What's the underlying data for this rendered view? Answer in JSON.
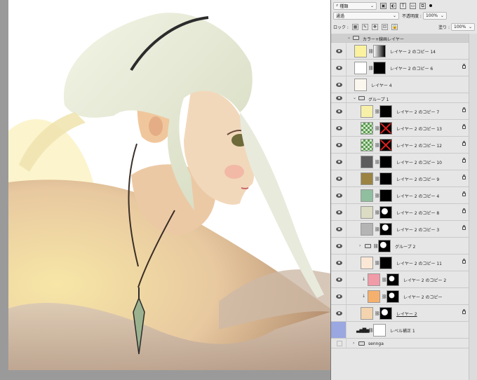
{
  "panel": {
    "search_kind": "種類",
    "blend_mode": "通過",
    "opacity_label": "不透明度 :",
    "opacity_value": "100%",
    "lock_label": "ロック :",
    "fill_label": "塗り :",
    "fill_value": "100%"
  },
  "layers": [
    {
      "name": "カラー+線画レイヤー",
      "kind": "group-header"
    },
    {
      "name": "レイヤー 2 のコピー 14",
      "thumb": "#fbf2a0",
      "mask": "gradient",
      "locked": false
    },
    {
      "name": "レイヤー 2 のコピー 6",
      "thumb": "#ffffff",
      "mask": "black",
      "locked": true
    },
    {
      "name": "レイヤー 4",
      "thumb": "sketch",
      "mask": "none",
      "locked": false
    },
    {
      "name": "グループ 1",
      "kind": "group"
    },
    {
      "name": "レイヤー 2 のコピー 7",
      "thumb": "#f7f0a8",
      "mask": "black",
      "locked": true
    },
    {
      "name": "レイヤー 2 のコピー 13",
      "thumb": "checker",
      "mask": "disabled",
      "locked": true
    },
    {
      "name": "レイヤー 2 のコピー 12",
      "thumb": "checker",
      "mask": "disabled",
      "locked": true
    },
    {
      "name": "レイヤー 2 のコピー 10",
      "thumb": "#5d5d5d",
      "mask": "black",
      "locked": true
    },
    {
      "name": "レイヤー 2 のコピー 9",
      "thumb": "#9b8344",
      "mask": "black",
      "locked": true
    },
    {
      "name": "レイヤー 2 のコピー 4",
      "thumb": "#8fbf9e",
      "mask": "black",
      "locked": true
    },
    {
      "name": "レイヤー 2 のコピー 8",
      "thumb": "#dcdcc4",
      "mask": "shape",
      "locked": true
    },
    {
      "name": "レイヤー 2 のコピー 3",
      "thumb": "#b4b4b4",
      "mask": "shape",
      "locked": true
    },
    {
      "name": "グループ 2",
      "kind": "subgroup"
    },
    {
      "name": "レイヤー 2 のコピー 11",
      "thumb": "#fbe7d6",
      "mask": "black",
      "locked": true
    },
    {
      "name": "レイヤー 2 のコピー 2",
      "thumb": "#f19aa8",
      "mask": "shape",
      "locked": false,
      "clipped": true
    },
    {
      "name": "レイヤー 2 のコピー",
      "thumb": "#f6b06d",
      "mask": "shape",
      "locked": false,
      "clipped": true
    },
    {
      "name": "レイヤー 2",
      "thumb": "#f3d4ae",
      "mask": "shape",
      "locked": true
    },
    {
      "name": "レベル補正 1",
      "kind": "adjustment"
    },
    {
      "name": "sennga",
      "kind": "folder-collapsed"
    }
  ],
  "colors": {
    "panel_bg": "#e6e6e6",
    "canvas_bg": "#ffffff",
    "workspace_bg": "#9a9a9a",
    "selection_accent": "#9aa7e0"
  }
}
